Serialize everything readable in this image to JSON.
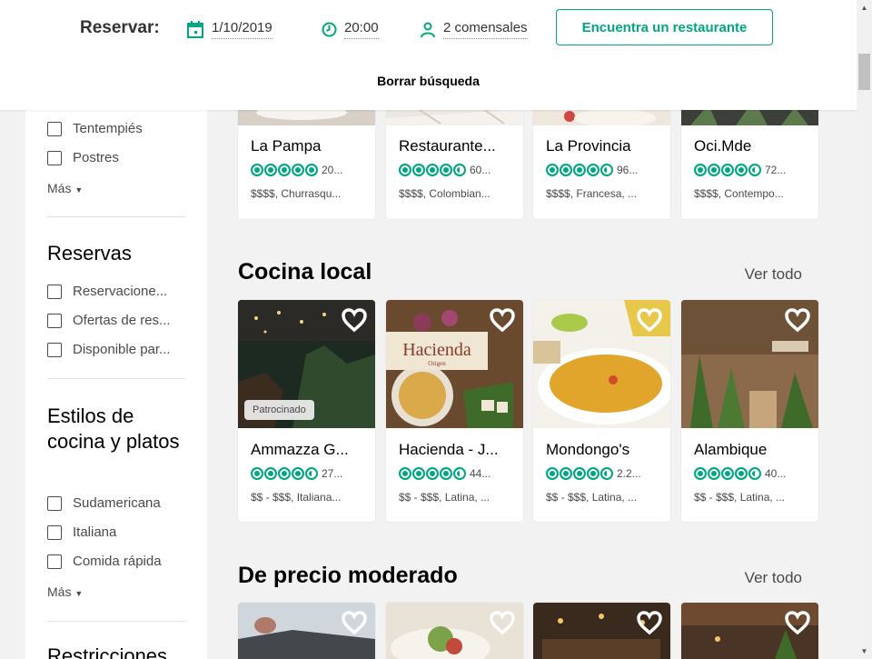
{
  "header": {
    "reservar_label": "Reservar:",
    "date": "1/10/2019",
    "time": "20:00",
    "guests": "2 comensales",
    "find_button": "Encuentra un restaurante",
    "clear_search": "Borrar búsqueda"
  },
  "sidebar": {
    "top_items": [
      "Tentempiés",
      "Postres"
    ],
    "more1": "Más",
    "reservas_title": "Reservas",
    "reservas_items": [
      "Reservacione...",
      "Ofertas de res...",
      "Disponible par..."
    ],
    "cocina_title": "Estilos de cocina y platos",
    "cocina_items": [
      "Sudamericana",
      "Italiana",
      "Comida rápida"
    ],
    "more2": "Más",
    "restricciones_title": "Restricciones"
  },
  "sections": {
    "top_cards": [
      {
        "name": "La Pampa",
        "count": "20...",
        "meta": "$$$$, Churrasqu..."
      },
      {
        "name": "Restaurante...",
        "count": "60...",
        "meta": "$$$$, Colombian..."
      },
      {
        "name": "La Provincia",
        "count": "96...",
        "meta": "$$$$, Francesa, ..."
      },
      {
        "name": "Oci.Mde",
        "count": "72...",
        "meta": "$$$$, Contempo..."
      }
    ],
    "cocina_local": {
      "title": "Cocina local",
      "see_all": "Ver todo",
      "sponsored": "Patrocinado",
      "hacienda_logo": "Hacienda",
      "hacienda_sub": "Origen",
      "cards": [
        {
          "name": "Ammazza G...",
          "count": "27...",
          "meta": "$$ - $$$, Italiana..."
        },
        {
          "name": "Hacienda - J...",
          "count": "44...",
          "meta": "$$ - $$$, Latina, ..."
        },
        {
          "name": "Mondongo's",
          "count": "2.2...",
          "meta": "$$ - $$$, Latina, ..."
        },
        {
          "name": "Alambique",
          "count": "40...",
          "meta": "$$ - $$$, Latina, ..."
        }
      ]
    },
    "moderado": {
      "title": "De precio moderado",
      "see_all": "Ver todo"
    }
  },
  "colors": {
    "accent": "#00a680",
    "background": "#f2f2f2"
  },
  "icons": [
    "calendar-icon",
    "clock-icon",
    "person-icon",
    "heart-icon",
    "chevron-down-icon"
  ]
}
